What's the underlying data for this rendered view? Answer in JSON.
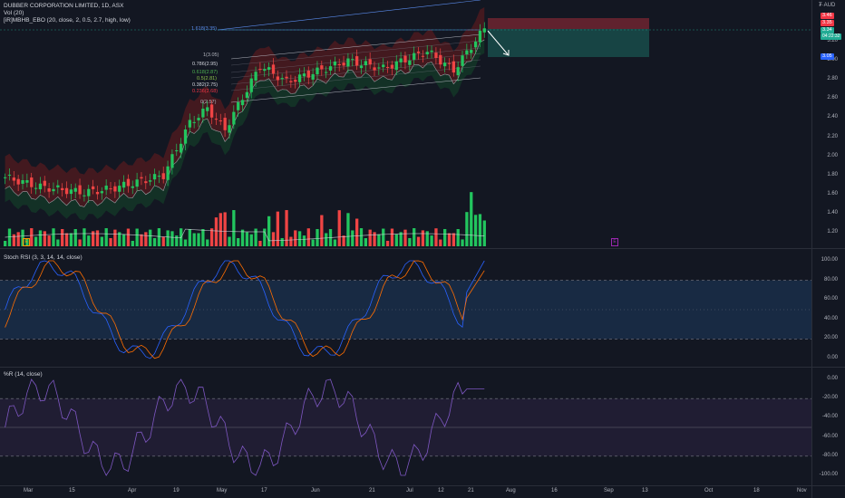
{
  "header": {
    "symbol": "DUBBER CORPORATION LIMITED, 1D, ASX",
    "vol": "Vol (20)",
    "indicator": "[iR]MBHB_EBO (20, close, 2, 0.5, 2.7, high, low)",
    "currency": "AUD"
  },
  "price_pane": {
    "y_ticks": [
      "1.20",
      "1.40",
      "1.60",
      "1.80",
      "2.00",
      "2.20",
      "2.40",
      "2.60",
      "2.80",
      "3.00",
      "3.20"
    ],
    "price_tags": [
      {
        "value": "3.46",
        "color": "#f23645"
      },
      {
        "value": "3.35",
        "color": "#f23645"
      },
      {
        "value": "3.34",
        "color": "#22ab94"
      },
      {
        "value": "04:22:32",
        "color": "#22ab94"
      },
      {
        "value": "3.05",
        "color": "#2962ff"
      }
    ],
    "fib_levels": [
      {
        "label": "1.618(3.35)",
        "color": "#5b8def"
      },
      {
        "label": "1(3.05)",
        "color": "#b2b5be"
      },
      {
        "label": "0.786(2.95)",
        "color": "#d1d4dc"
      },
      {
        "label": "0.618(2.87)",
        "color": "#4caf50"
      },
      {
        "label": "0.5(2.81)",
        "color": "#8bc34a"
      },
      {
        "label": "0.382(2.75)",
        "color": "#d1d4dc"
      },
      {
        "label": "0.236(2.68)",
        "color": "#f23645"
      },
      {
        "label": "0(2.57)",
        "color": "#b2b5be"
      }
    ],
    "marker_e": "E"
  },
  "stoch_pane": {
    "title": "Stoch RSI (3, 3, 14, 14, close)",
    "y_ticks": [
      "100.00",
      "80.00",
      "60.00",
      "40.00",
      "20.00",
      "0.00"
    ]
  },
  "wr_pane": {
    "title": "%R (14, close)",
    "y_ticks": [
      "0.00",
      "-20.00",
      "-40.00",
      "-60.00",
      "-80.00",
      "-100.00"
    ]
  },
  "x_axis": {
    "labels": [
      "Mar",
      "15",
      "Apr",
      "19",
      "May",
      "17",
      "Jun",
      "21",
      "Jul",
      "12",
      "21",
      "Aug",
      "16",
      "Sep",
      "13",
      "Oct",
      "18",
      "Nov"
    ]
  },
  "colors": {
    "up": "#22c55e",
    "down": "#ef4444",
    "bg": "#131722"
  }
}
